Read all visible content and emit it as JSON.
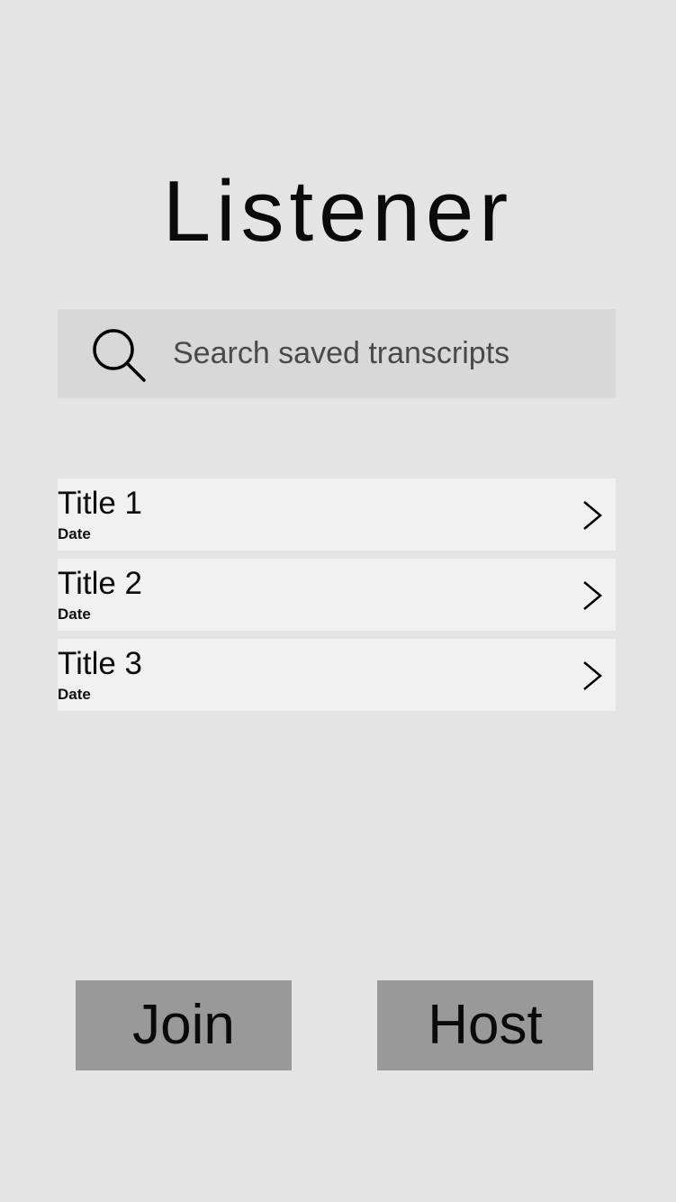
{
  "header": {
    "title": "Listener"
  },
  "search": {
    "icon": "search-icon",
    "placeholder": "Search saved transcripts",
    "value": ""
  },
  "transcripts": [
    {
      "title": "Title 1",
      "date": "Date",
      "icon": "chevron-right-icon"
    },
    {
      "title": "Title 2",
      "date": "Date",
      "icon": "chevron-right-icon"
    },
    {
      "title": "Title 3",
      "date": "Date",
      "icon": "chevron-right-icon"
    }
  ],
  "actions": {
    "join_label": "Join",
    "host_label": "Host"
  },
  "colors": {
    "background": "#e4e4e4",
    "search_background": "#d8d8d8",
    "list_item_background": "#f1f1f1",
    "button_background": "#999999",
    "text": "#0d0d0d",
    "placeholder": "#4a4a4a"
  }
}
